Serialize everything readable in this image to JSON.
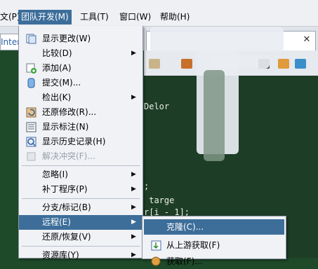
{
  "menubar": {
    "items": [
      {
        "label": "文(P)",
        "active": false
      },
      {
        "label": "团队开发(M)",
        "active": true
      },
      {
        "label": "工具(T)",
        "active": false
      },
      {
        "label": "窗口(W)",
        "active": false
      },
      {
        "label": "帮助(H)",
        "active": false
      }
    ]
  },
  "background": {
    "left_tab": "Interf",
    "close_glyph": "✕",
    "code_lines": [
      "Delor",
      "",
      ";",
      " targe",
      "r[i - 1];"
    ]
  },
  "team_menu": {
    "items": [
      {
        "label": "显示更改(W)",
        "icon": "changes-icon",
        "submenu": false
      },
      {
        "label": "比较(D)",
        "icon": "",
        "submenu": true
      },
      {
        "label": "添加(A)",
        "icon": "add-icon",
        "submenu": false
      },
      {
        "label": "提交(M)...",
        "icon": "commit-icon",
        "submenu": false
      },
      {
        "label": "检出(K)",
        "icon": "",
        "submenu": true
      },
      {
        "label": "还原修改(R)...",
        "icon": "revert-icon",
        "submenu": false
      },
      {
        "label": "显示标注(N)",
        "icon": "annotations-icon",
        "submenu": false
      },
      {
        "label": "显示历史记录(H)",
        "icon": "history-icon",
        "submenu": false
      },
      {
        "label": "解决冲突(F)...",
        "icon": "resolve-icon",
        "submenu": false,
        "disabled": true
      },
      {
        "label": "忽略(I)",
        "icon": "",
        "submenu": true
      },
      {
        "label": "补丁程序(P)",
        "icon": "",
        "submenu": true
      },
      {
        "label": "分支/标记(B)",
        "icon": "",
        "submenu": true
      },
      {
        "label": "远程(E)",
        "icon": "",
        "submenu": true,
        "highlighted": true
      },
      {
        "label": "还原/恢复(V)",
        "icon": "",
        "submenu": true
      },
      {
        "label": "资源库(Y)",
        "icon": "",
        "submenu": true
      }
    ]
  },
  "remote_submenu": {
    "items": [
      {
        "label": "克隆(C)...",
        "highlighted": true
      },
      {
        "label": "从上游获取(F)",
        "icon": "fetch-upstream-icon"
      },
      {
        "label": "获取(F)...",
        "icon": "fetch-icon"
      }
    ]
  },
  "colors": {
    "menu_highlight": "#3d6e9a",
    "menu_background": "#f0f2f6",
    "editor_background": "#1e3d26"
  }
}
